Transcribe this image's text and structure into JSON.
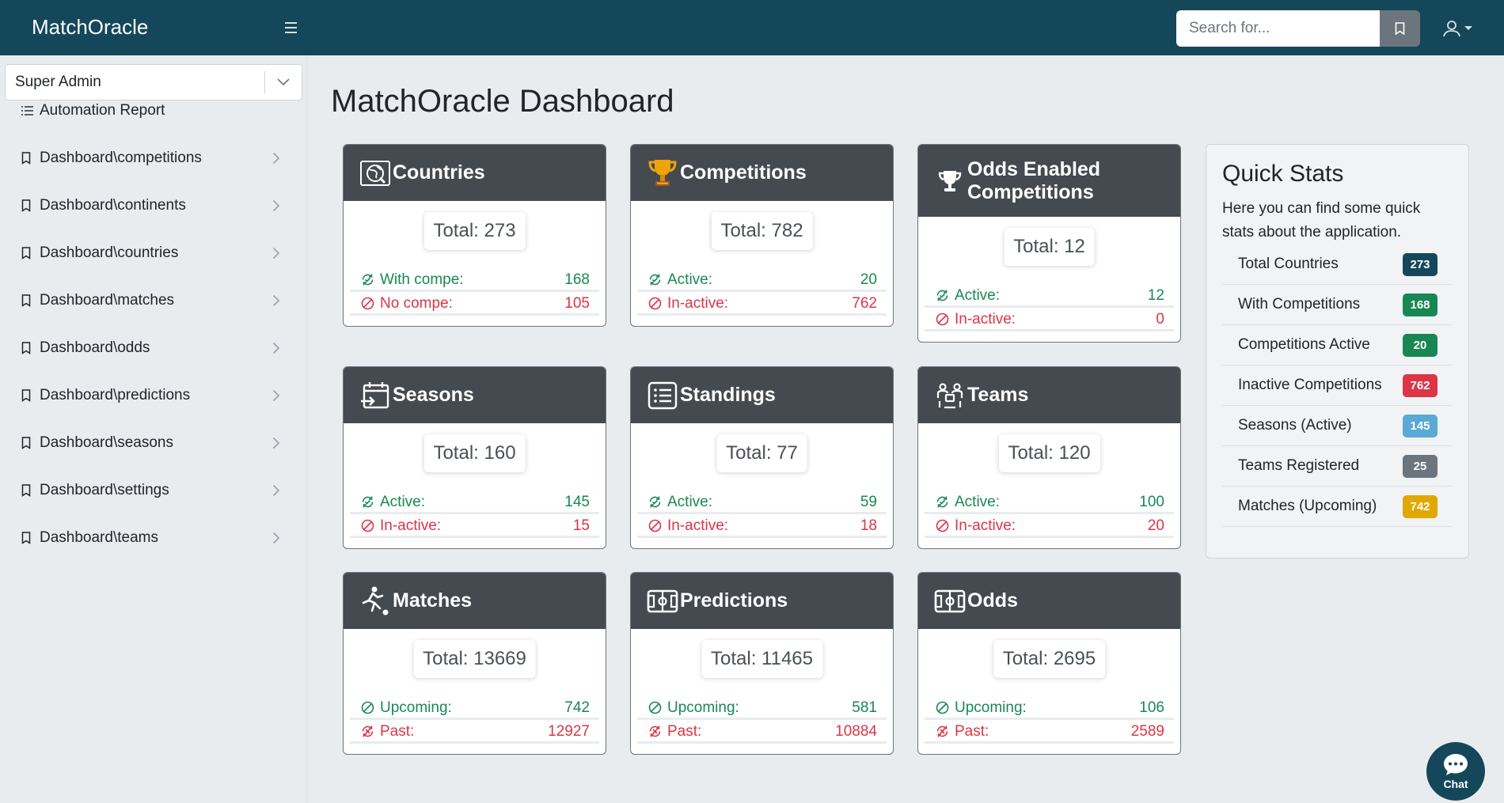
{
  "header": {
    "brand": "MatchOracle",
    "search_placeholder": "Search for..."
  },
  "sidebar": {
    "role": "Super Admin",
    "items": [
      {
        "label": "Automation Report",
        "icon": "list-icon",
        "has_arrow": false
      },
      {
        "label": "Dashboard\\competitions",
        "icon": "bookmark-icon",
        "has_arrow": true
      },
      {
        "label": "Dashboard\\continents",
        "icon": "bookmark-icon",
        "has_arrow": true
      },
      {
        "label": "Dashboard\\countries",
        "icon": "bookmark-icon",
        "has_arrow": true
      },
      {
        "label": "Dashboard\\matches",
        "icon": "bookmark-icon",
        "has_arrow": true
      },
      {
        "label": "Dashboard\\odds",
        "icon": "bookmark-icon",
        "has_arrow": true
      },
      {
        "label": "Dashboard\\predictions",
        "icon": "bookmark-icon",
        "has_arrow": true
      },
      {
        "label": "Dashboard\\seasons",
        "icon": "bookmark-icon",
        "has_arrow": true
      },
      {
        "label": "Dashboard\\settings",
        "icon": "bookmark-icon",
        "has_arrow": true
      },
      {
        "label": "Dashboard\\teams",
        "icon": "bookmark-icon",
        "has_arrow": true
      }
    ]
  },
  "main": {
    "title": "MatchOracle Dashboard",
    "cards": [
      {
        "title": "Countries",
        "icon": "globe-icon",
        "total": "Total: 273",
        "rows": [
          {
            "label": "With compe:",
            "value": "168",
            "status": "positive"
          },
          {
            "label": "No compe:",
            "value": "105",
            "status": "negative"
          }
        ]
      },
      {
        "title": "Competitions",
        "icon": "trophy-icon",
        "total": "Total: 782",
        "rows": [
          {
            "label": "Active:",
            "value": "20",
            "status": "positive"
          },
          {
            "label": "In-active:",
            "value": "762",
            "status": "negative"
          }
        ]
      },
      {
        "title": "Odds Enabled Competitions",
        "icon": "cup-icon",
        "total": "Total: 12",
        "rows": [
          {
            "label": "Active:",
            "value": "12",
            "status": "positive"
          },
          {
            "label": "In-active:",
            "value": "0",
            "status": "negative"
          }
        ]
      },
      {
        "title": "Seasons",
        "icon": "calendar-icon",
        "total": "Total: 160",
        "rows": [
          {
            "label": "Active:",
            "value": "145",
            "status": "positive"
          },
          {
            "label": "In-active:",
            "value": "15",
            "status": "negative"
          }
        ]
      },
      {
        "title": "Standings",
        "icon": "list-box-icon",
        "total": "Total: 77",
        "rows": [
          {
            "label": "Active:",
            "value": "59",
            "status": "positive"
          },
          {
            "label": "In-active:",
            "value": "18",
            "status": "negative"
          }
        ]
      },
      {
        "title": "Teams",
        "icon": "team-icon",
        "total": "Total: 120",
        "rows": [
          {
            "label": "Active:",
            "value": "100",
            "status": "positive"
          },
          {
            "label": "In-active:",
            "value": "20",
            "status": "negative"
          }
        ]
      },
      {
        "title": "Matches",
        "icon": "player-icon",
        "total": "Total: 13669",
        "rows": [
          {
            "label": "Upcoming:",
            "value": "742",
            "status": "positive"
          },
          {
            "label": "Past:",
            "value": "12927",
            "status": "negative"
          }
        ]
      },
      {
        "title": "Predictions",
        "icon": "pitch-icon",
        "total": "Total: 11465",
        "rows": [
          {
            "label": "Upcoming:",
            "value": "581",
            "status": "positive"
          },
          {
            "label": "Past:",
            "value": "10884",
            "status": "negative"
          }
        ]
      },
      {
        "title": "Odds",
        "icon": "pitch-icon",
        "total": "Total: 2695",
        "rows": [
          {
            "label": "Upcoming:",
            "value": "106",
            "status": "positive"
          },
          {
            "label": "Past:",
            "value": "2589",
            "status": "negative"
          }
        ]
      }
    ]
  },
  "quick_stats": {
    "title": "Quick Stats",
    "description": "Here you can find some quick stats about the application.",
    "items": [
      {
        "label": "Total Countries",
        "value": "273",
        "color": "#14475a"
      },
      {
        "label": "With Competitions",
        "value": "168",
        "color": "#198754"
      },
      {
        "label": "Competitions Active",
        "value": "20",
        "color": "#198754"
      },
      {
        "label": "Inactive Competitions",
        "value": "762",
        "color": "#dc3545"
      },
      {
        "label": "Seasons (Active)",
        "value": "145",
        "color": "#5aa9d6"
      },
      {
        "label": "Teams Registered",
        "value": "25",
        "color": "#6c757d"
      },
      {
        "label": "Matches (Upcoming)",
        "value": "742",
        "color": "#e0a800"
      }
    ]
  },
  "chat": {
    "label": "Chat"
  },
  "colors": {
    "navbar": "#14475a",
    "card_header": "#444a50",
    "positive": "#198754",
    "negative": "#dc3545"
  }
}
